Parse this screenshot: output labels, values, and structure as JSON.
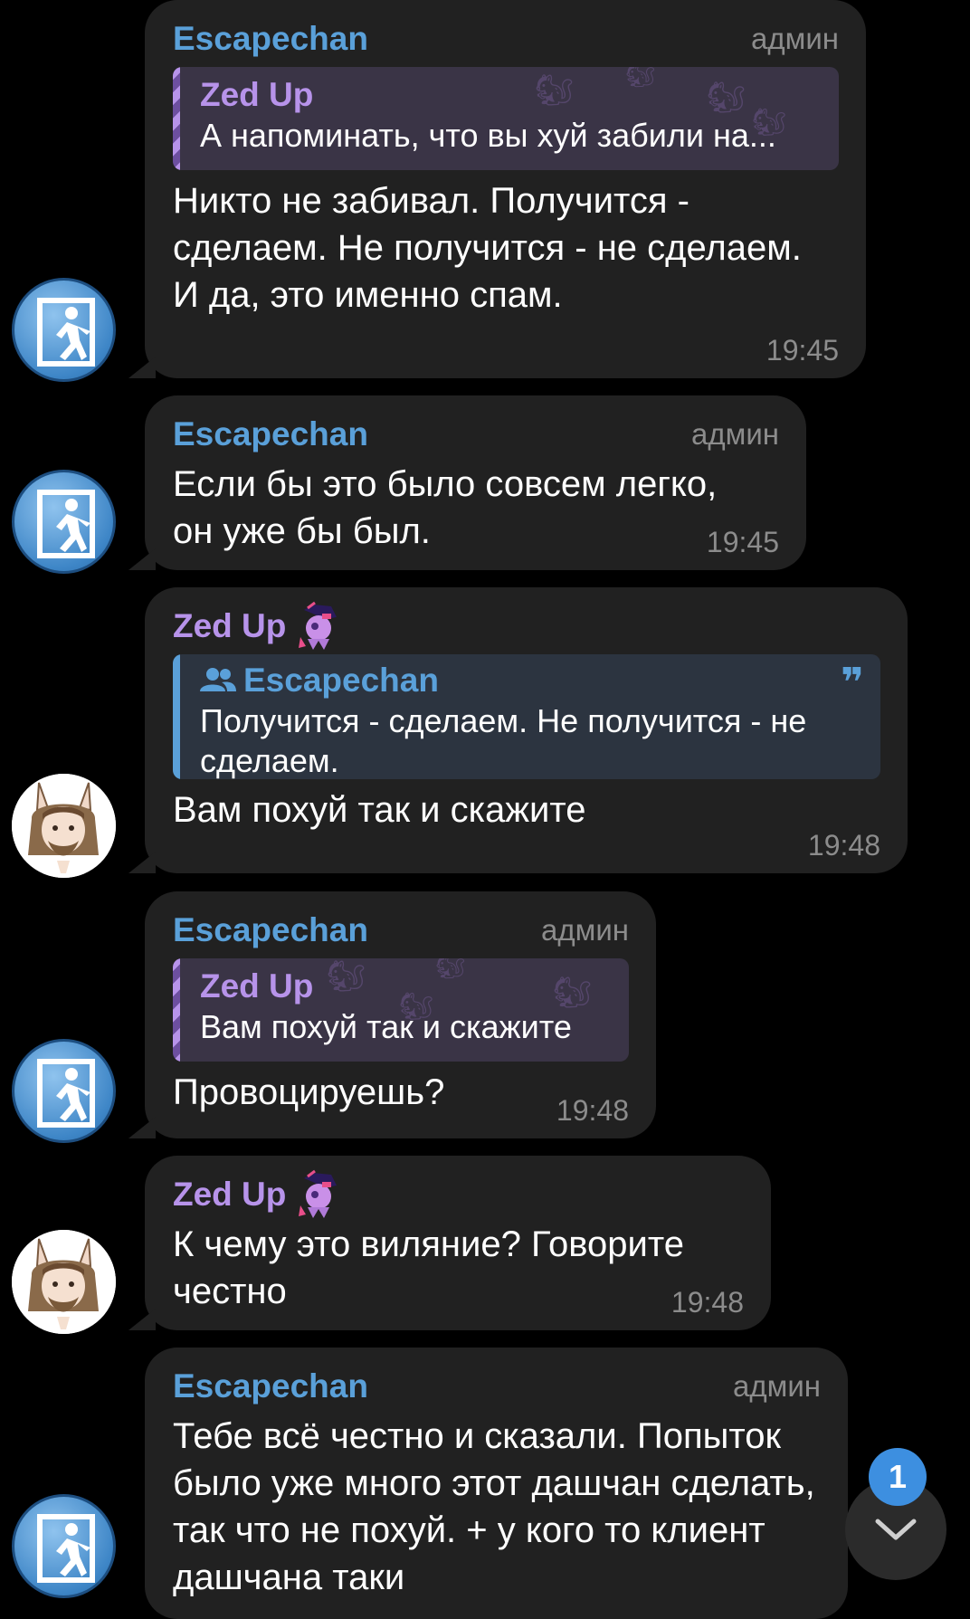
{
  "messages": [
    {
      "sender": "Escapechan",
      "role": "админ",
      "reply": {
        "name": "Zed Up",
        "text": "А напоминать, что вы хуй забили на..."
      },
      "text": "Никто не забивал. Получится - сделаем. Не получится - не сделаем. И да, это именно спам.",
      "time": "19:45"
    },
    {
      "sender": "Escapechan",
      "role": "админ",
      "text": "Если бы это было совсем легко, он уже бы был.",
      "time": "19:45"
    },
    {
      "sender": "Zed Up",
      "quote": {
        "name": "Escapechan",
        "text": "Получится - сделаем. Не получится - не сделаем."
      },
      "text": "Вам похуй так и скажите",
      "time": "19:48"
    },
    {
      "sender": "Escapechan",
      "role": "админ",
      "reply": {
        "name": "Zed Up",
        "text": "Вам похуй так и скажите"
      },
      "text": "Провоцируешь?",
      "time": "19:48"
    },
    {
      "sender": "Zed Up",
      "text": "К чему это виляние? Говорите честно",
      "time": "19:48"
    },
    {
      "sender": "Escapechan",
      "role": "админ",
      "text": "Тебе всё честно и сказали. Попыток было уже много этот дашчан сделать, так что не похуй. + у кого то клиент дашчана таки"
    }
  ],
  "scroll_down": {
    "unread_count": "1",
    "icon": "chevron-down-icon"
  },
  "colors": {
    "background": "#000000",
    "bubble": "#212121",
    "admin_name": "#5aa0d9",
    "user_name": "#b793ea",
    "badge": "#3d8fe0"
  }
}
